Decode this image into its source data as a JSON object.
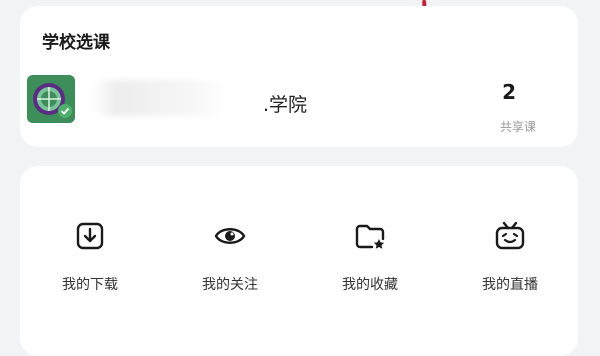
{
  "school_card": {
    "title": "学校选课",
    "school_name": ".学院",
    "course_count": "2",
    "course_count_label": "共享课"
  },
  "actions": [
    {
      "label": "我的下载",
      "icon": "download-icon"
    },
    {
      "label": "我的关注",
      "icon": "eye-icon"
    },
    {
      "label": "我的收藏",
      "icon": "folder-star-icon"
    },
    {
      "label": "我的直播",
      "icon": "tv-icon"
    }
  ],
  "colors": {
    "background": "#f2f3f5",
    "card": "#ffffff",
    "accent_red": "#c4243a",
    "logo_green": "#3e8e5c",
    "logo_purple": "#5b2d82"
  }
}
